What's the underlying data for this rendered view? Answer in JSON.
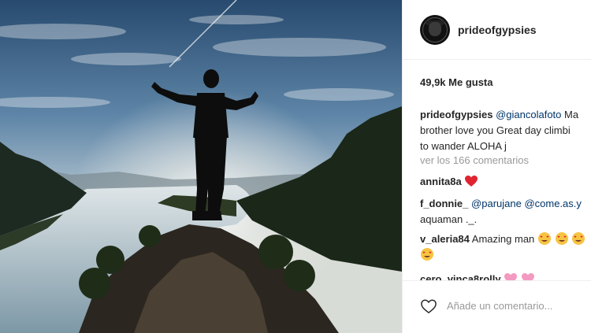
{
  "post": {
    "username": "prideofgypsies",
    "likes": "49,9k Me gusta",
    "caption": {
      "username": "prideofgypsies",
      "mention": "@giancolafoto",
      "line1_rest": " Ma",
      "line2": "brother love you Great day climbi",
      "line3": "to wander ALOHA j"
    },
    "view_all": "ver los 166 comentarios",
    "comments": [
      {
        "username": "annita8a",
        "text": "",
        "emoji": "heart"
      },
      {
        "username": "f_donnie_",
        "mention1": "@parujane",
        "mention2": "@come.as.y",
        "line2": "aquaman ._."
      },
      {
        "username": "v_aleria84",
        "text": " Amazing man"
      },
      {
        "username": "cero_vinca8rolly",
        "text": ""
      }
    ],
    "add_comment_placeholder": "Añade un comentario..."
  }
}
